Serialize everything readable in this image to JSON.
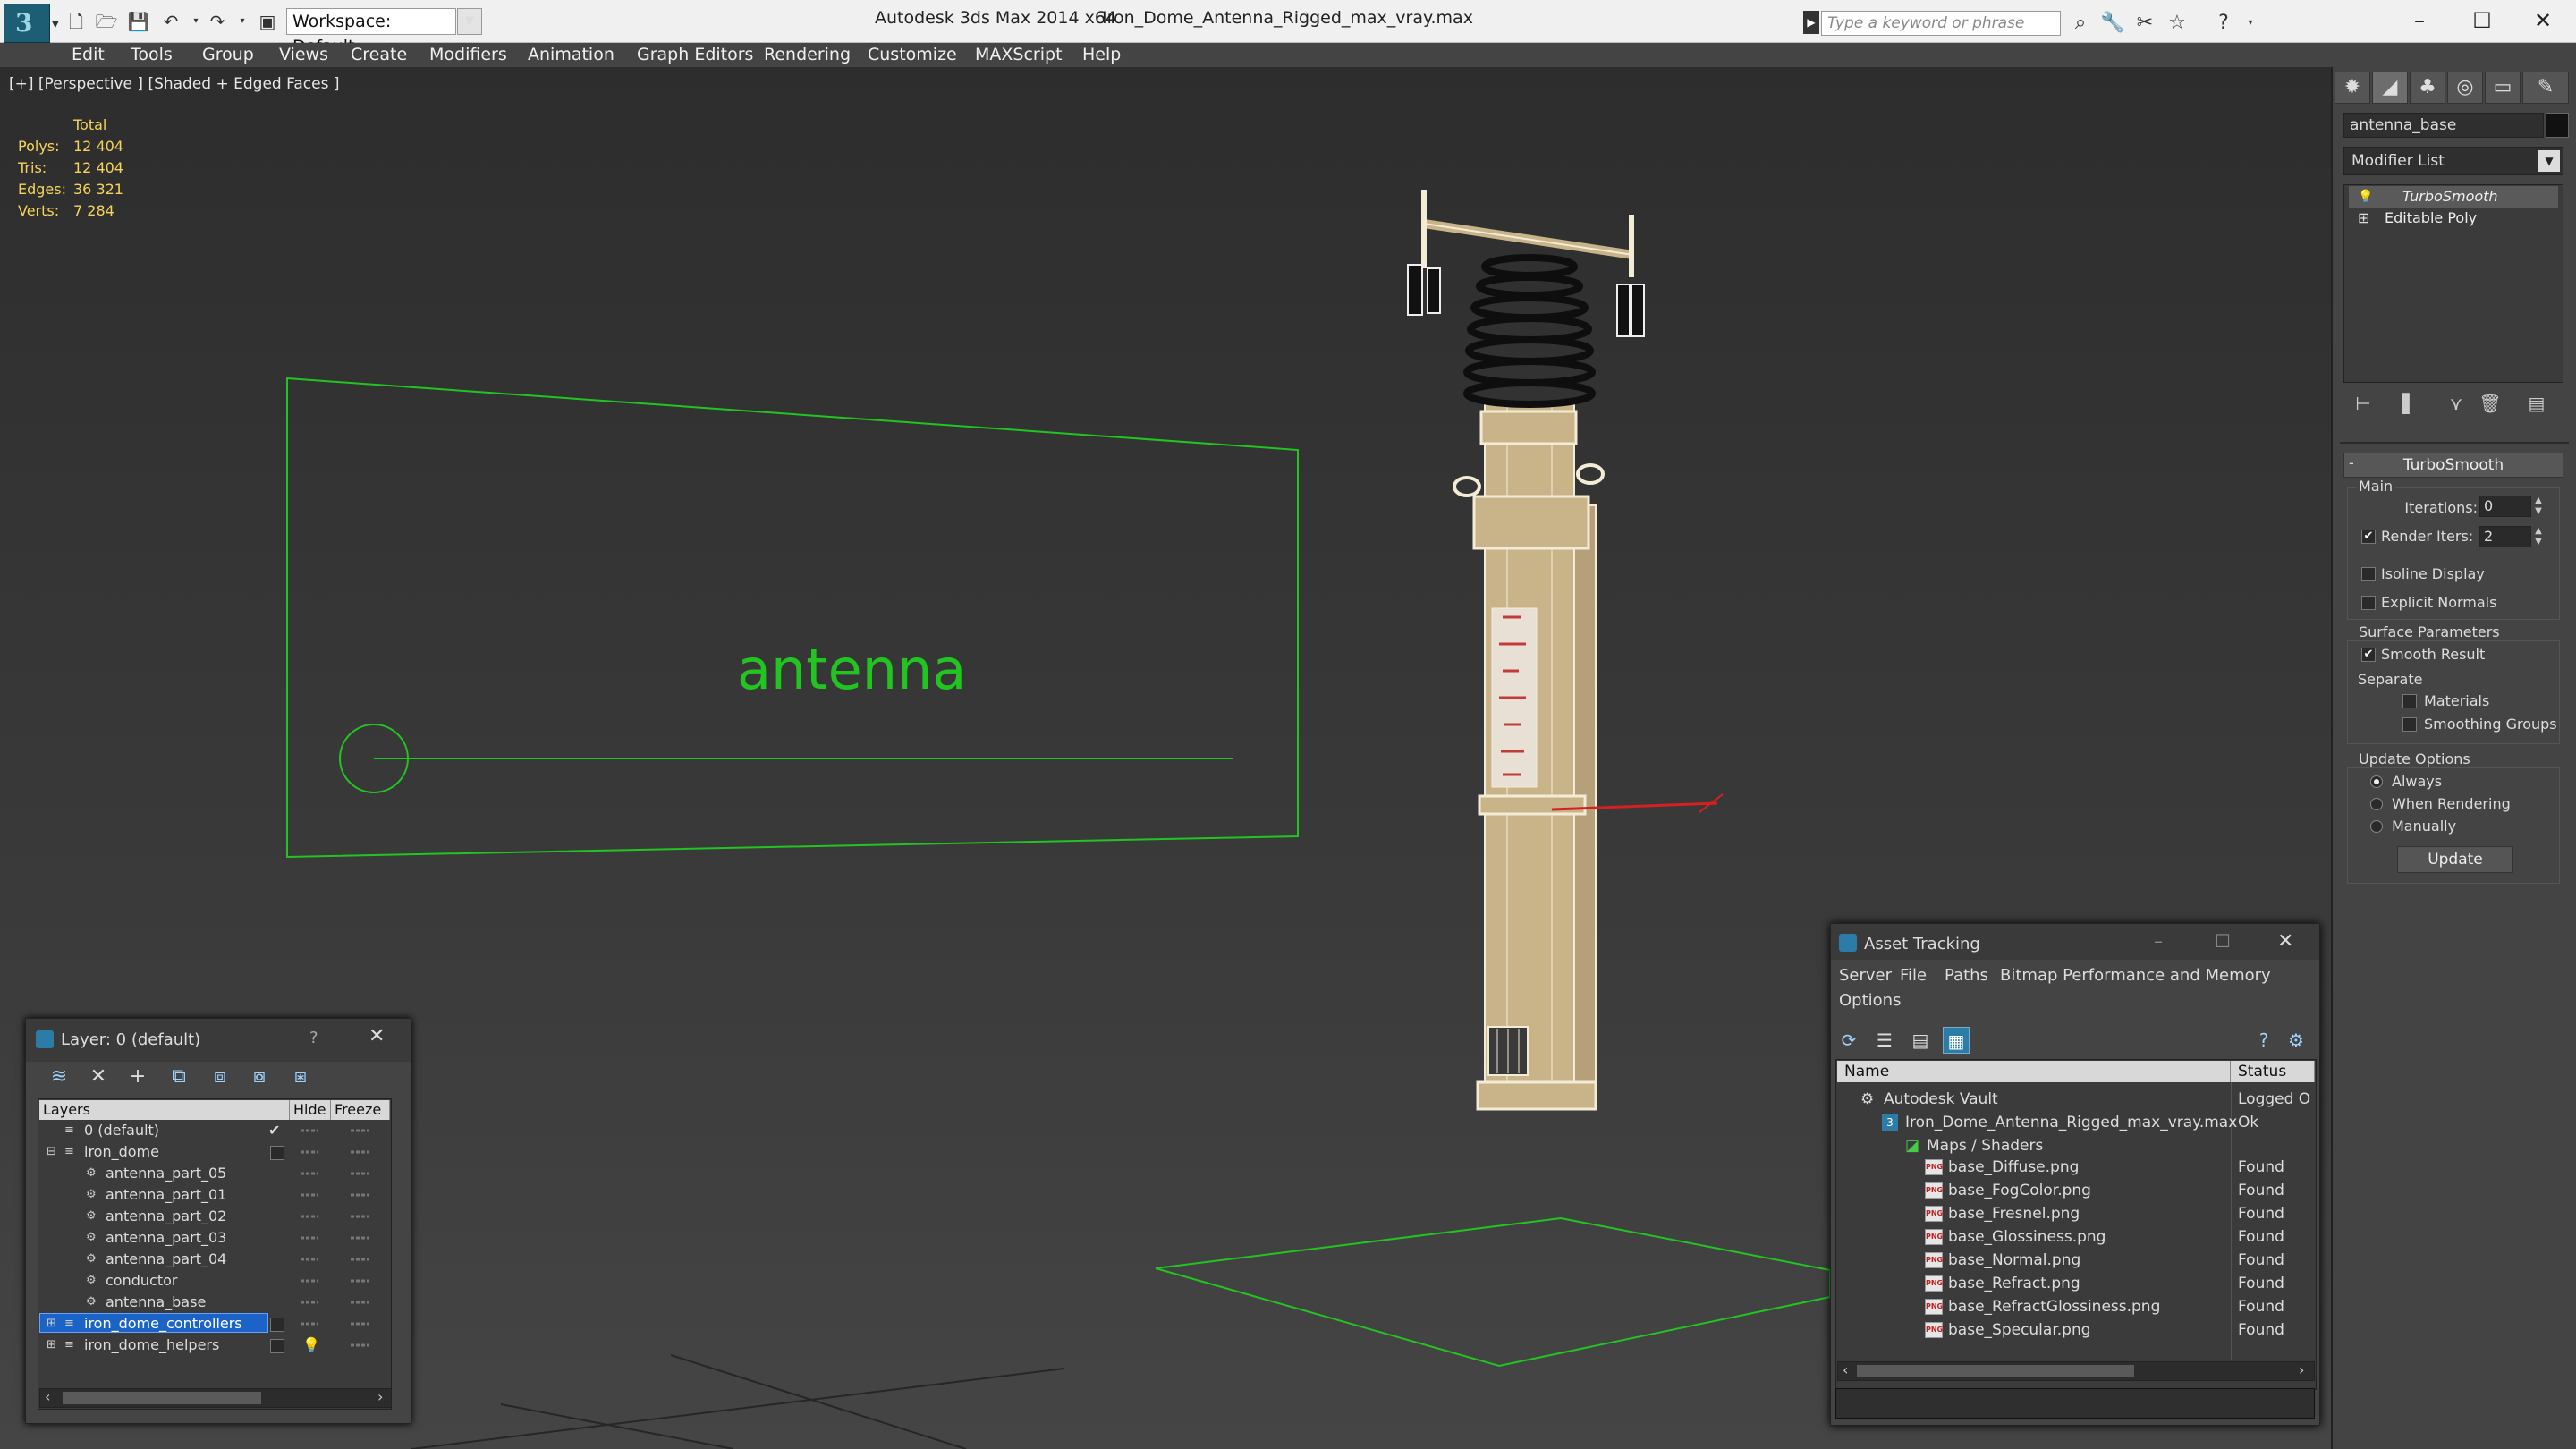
{
  "titlebar": {
    "workspace": "Workspace: Default",
    "app_name": "Autodesk 3ds Max  2014 x64",
    "file_name": "Iron_Dome_Antenna_Rigged_max_vray.max",
    "search_placeholder": "Type a keyword or phrase"
  },
  "menu": [
    "Edit",
    "Tools",
    "Group",
    "Views",
    "Create",
    "Modifiers",
    "Animation",
    "Graph Editors",
    "Rendering",
    "Customize",
    "MAXScript",
    "Help"
  ],
  "viewport": {
    "label": "[+] [Perspective ] [Shaded + Edged Faces ]",
    "stats": {
      "total_label": "Total",
      "rows": [
        {
          "label": "Polys:",
          "value": "12 404"
        },
        {
          "label": "Tris:",
          "value": "12 404"
        },
        {
          "label": "Edges:",
          "value": "36 321"
        },
        {
          "label": "Verts:",
          "value": "7 284"
        }
      ]
    },
    "shape_text": "antenna"
  },
  "command_panel": {
    "object_name": "antenna_base",
    "modifier_list": "Modifier List",
    "stack": [
      "TurboSmooth",
      "Editable Poly"
    ],
    "rollout": "TurboSmooth",
    "main_group": "Main",
    "iterations_label": "Iterations:",
    "iterations_value": "0",
    "render_iters_label": "Render Iters:",
    "render_iters_value": "2",
    "isoline": "Isoline Display",
    "explicit_normals": "Explicit Normals",
    "surface_params": "Surface Parameters",
    "smooth_result": "Smooth Result",
    "separate": "Separate",
    "materials": "Materials",
    "smoothing_groups": "Smoothing Groups",
    "update_options": "Update Options",
    "always": "Always",
    "when_rendering": "When Rendering",
    "manually": "Manually",
    "update_button": "Update"
  },
  "layer_dialog": {
    "title": "Layer: 0 (default)",
    "help": "?",
    "columns": [
      "Layers",
      "Hide",
      "Freeze"
    ],
    "rows": [
      {
        "name": "0 (default)",
        "level": 0
      },
      {
        "name": "iron_dome",
        "level": 0
      },
      {
        "name": "antenna_part_05",
        "level": 1
      },
      {
        "name": "antenna_part_01",
        "level": 1
      },
      {
        "name": "antenna_part_02",
        "level": 1
      },
      {
        "name": "antenna_part_03",
        "level": 1
      },
      {
        "name": "antenna_part_04",
        "level": 1
      },
      {
        "name": "conductor",
        "level": 1
      },
      {
        "name": "antenna_base",
        "level": 1
      },
      {
        "name": "iron_dome_controllers",
        "level": 0
      },
      {
        "name": "iron_dome_helpers",
        "level": 0
      }
    ]
  },
  "asset_dialog": {
    "title": "Asset Tracking",
    "menu": [
      "Server",
      "File",
      "Paths",
      "Bitmap Performance and Memory",
      "Options"
    ],
    "columns": [
      "Name",
      "Status"
    ],
    "rows": [
      {
        "name": "Autodesk Vault",
        "status": "Logged O"
      },
      {
        "name": "Iron_Dome_Antenna_Rigged_max_vray.max",
        "status": "Ok"
      },
      {
        "name": "Maps / Shaders",
        "status": ""
      },
      {
        "name": "base_Diffuse.png",
        "status": "Found"
      },
      {
        "name": "base_FogColor.png",
        "status": "Found"
      },
      {
        "name": "base_Fresnel.png",
        "status": "Found"
      },
      {
        "name": "base_Glossiness.png",
        "status": "Found"
      },
      {
        "name": "base_Normal.png",
        "status": "Found"
      },
      {
        "name": "base_Refract.png",
        "status": "Found"
      },
      {
        "name": "base_RefractGlossiness.png",
        "status": "Found"
      },
      {
        "name": "base_Specular.png",
        "status": "Found"
      }
    ]
  },
  "colors": {
    "stats": "#f4d45c",
    "spline": "#22c422",
    "selection": "#1c63c7",
    "mesh": "#c9b48a"
  }
}
